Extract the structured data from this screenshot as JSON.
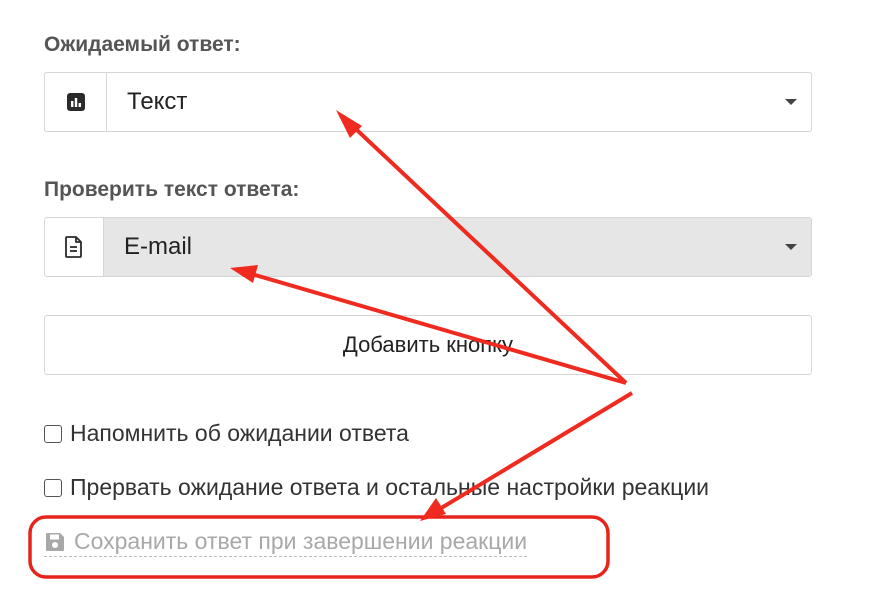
{
  "form": {
    "expected_answer": {
      "label": "Ожидаемый ответ:",
      "icon": "bar-chart-icon",
      "value": "Текст"
    },
    "check_answer_text": {
      "label": "Проверить текст ответа:",
      "icon": "document-icon",
      "value": "E-mail"
    },
    "add_button_label": "Добавить кнопку",
    "checkboxes": [
      {
        "label": "Напомнить об ожидании ответа",
        "checked": false
      },
      {
        "label": "Прервать ожидание ответа и остальные настройки реакции",
        "checked": false
      }
    ],
    "save_link": {
      "icon": "floppy-disk-icon",
      "label": "Сохранить ответ при завершении реакции"
    }
  },
  "annotation": {
    "arrow_color": "#f02a1f",
    "highlight_color": "#e8231b"
  }
}
